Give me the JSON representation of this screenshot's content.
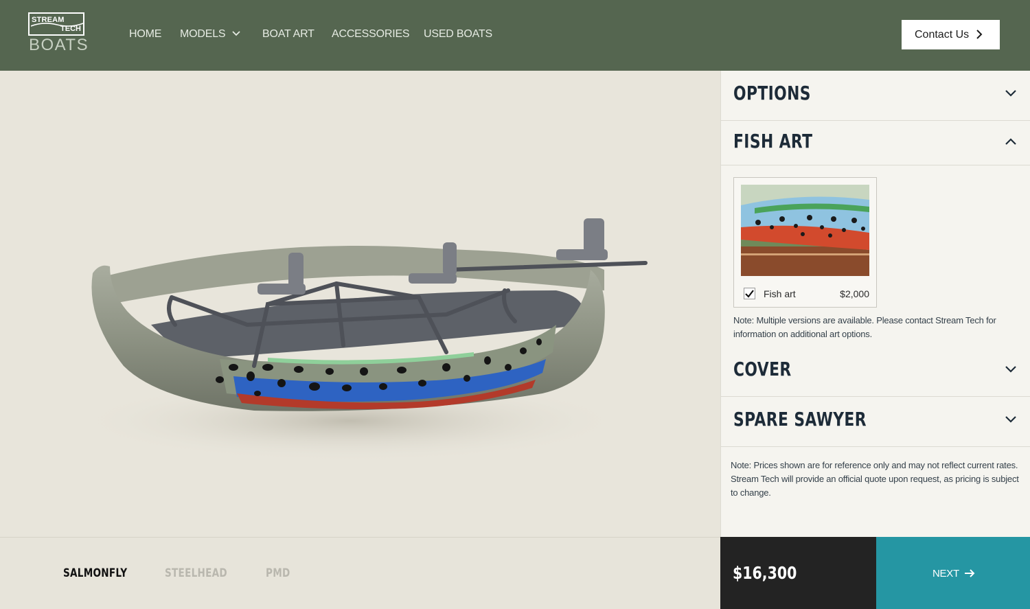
{
  "brand": {
    "logo_top_line1": "STREAM",
    "logo_top_line2": "TECH",
    "logo_bottom": "BOATS"
  },
  "nav": {
    "items": [
      {
        "label": "HOME"
      },
      {
        "label": "MODELS",
        "has_dropdown": true
      },
      {
        "label": "BOAT ART"
      },
      {
        "label": "ACCESSORIES"
      },
      {
        "label": "USED BOATS"
      }
    ],
    "contact_label": "Contact Us"
  },
  "panel": {
    "sections": [
      {
        "title": "OPTIONS",
        "expanded": false
      },
      {
        "title": "FISH ART",
        "expanded": true
      },
      {
        "title": "COVER",
        "expanded": false
      },
      {
        "title": "SPARE SAWYER",
        "expanded": false
      }
    ],
    "fish_art": {
      "option_label": "Fish art",
      "option_price": "$2,000",
      "checked": true,
      "note": "Note: Multiple versions are available. Please contact Stream Tech for information on additional art options."
    },
    "price_note": "Note: Prices shown are for reference only and may not reflect current rates. Stream Tech will provide an official quote upon request, as pricing is subject to change."
  },
  "variants": [
    {
      "label": "SALMONFLY",
      "active": true
    },
    {
      "label": "STEELHEAD",
      "active": false
    },
    {
      "label": "PMD",
      "active": false
    }
  ],
  "total_price": "$16,300",
  "next_label": "NEXT",
  "colors": {
    "header_bg": "#556650",
    "accent_teal": "#2596a3",
    "price_bg": "#232323",
    "heading_navy": "#1d2b38"
  },
  "icons": {
    "nav_dropdown": "chevron-down-icon",
    "contact": "chevron-right-icon",
    "section_collapsed": "chevron-down-icon",
    "section_expanded": "chevron-up-icon",
    "checkbox": "checkmark-icon",
    "next": "arrow-right-icon"
  }
}
